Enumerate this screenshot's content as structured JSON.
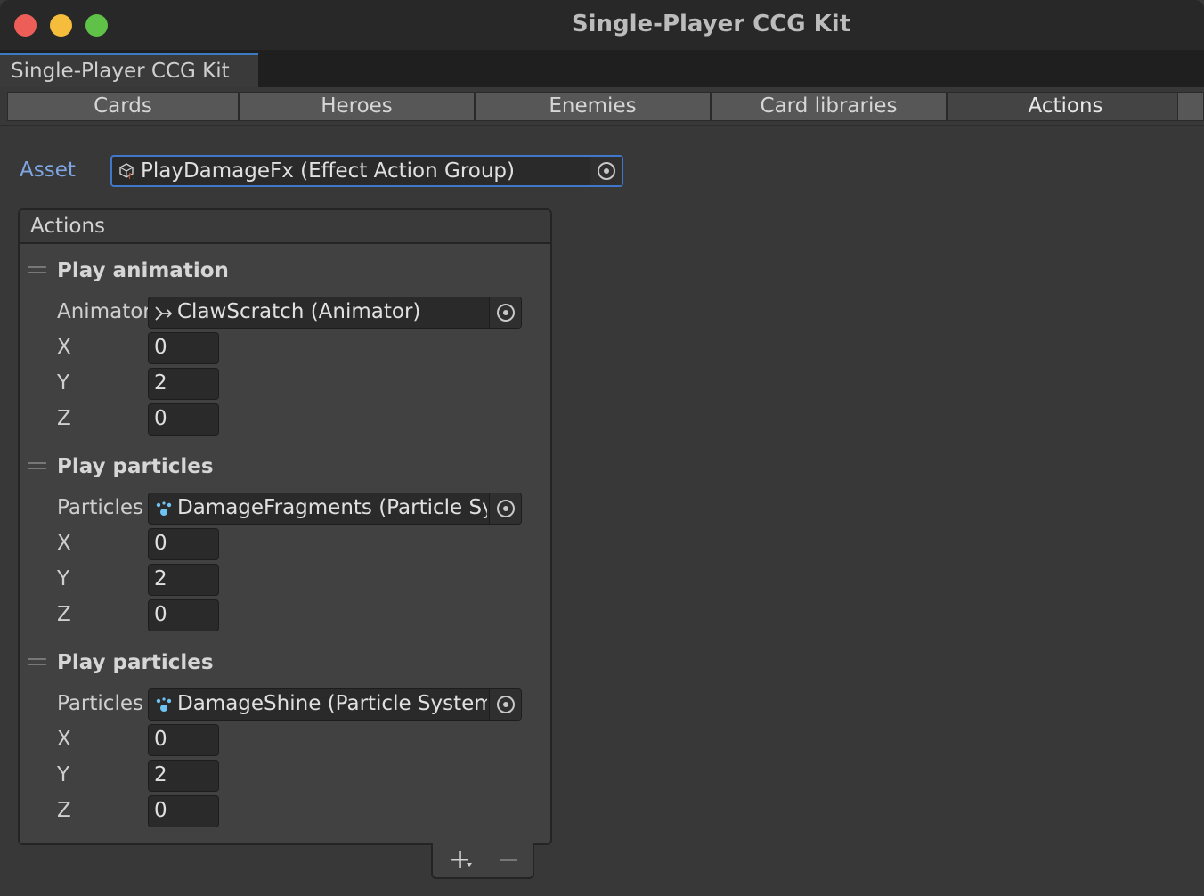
{
  "window": {
    "title": "Single-Player CCG Kit"
  },
  "document_tab": {
    "label": "Single-Player CCG Kit"
  },
  "nav_tabs": [
    {
      "label": "Cards"
    },
    {
      "label": "Heroes"
    },
    {
      "label": "Enemies"
    },
    {
      "label": "Card libraries"
    },
    {
      "label": "Actions",
      "active": true
    }
  ],
  "asset": {
    "label": "Asset",
    "value": "PlayDamageFx (Effect Action Group)",
    "icon": "scriptable-object-icon"
  },
  "actions_list": {
    "header": "Actions",
    "entries": [
      {
        "title": "Play animation",
        "object_label": "Animator",
        "object_value": "ClawScratch (Animator)",
        "object_icon": "animator-icon",
        "x_label": "X",
        "x": "0",
        "y_label": "Y",
        "y": "2",
        "z_label": "Z",
        "z": "0"
      },
      {
        "title": "Play particles",
        "object_label": "Particles",
        "object_value": "DamageFragments (Particle System)",
        "object_icon": "particle-system-icon",
        "x_label": "X",
        "x": "0",
        "y_label": "Y",
        "y": "2",
        "z_label": "Z",
        "z": "0"
      },
      {
        "title": "Play particles",
        "object_label": "Particles",
        "object_value": "DamageShine (Particle System)",
        "object_icon": "particle-system-icon",
        "x_label": "X",
        "x": "0",
        "y_label": "Y",
        "y": "2",
        "z_label": "Z",
        "z": "0"
      }
    ],
    "footer": {
      "add": "+",
      "remove": "−"
    }
  },
  "colors": {
    "background": "#383838",
    "accent_blue": "#3f78c8",
    "asset_label": "#7fa6e2",
    "field_bg": "#2a2a2a",
    "close": "#ee5e58",
    "minimize": "#f5bd3b",
    "maximize": "#5fc147"
  }
}
